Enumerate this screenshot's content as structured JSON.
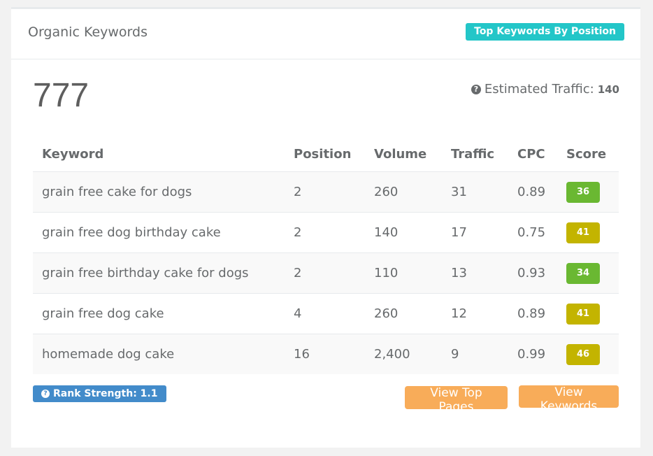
{
  "card": {
    "title": "Organic Keywords",
    "top_badge": "Top Keywords By Position",
    "total_keywords": "777",
    "estimated_traffic_label": "Estimated Traffic:",
    "estimated_traffic_value": "140"
  },
  "table": {
    "headers": [
      "Keyword",
      "Position",
      "Volume",
      "Traffic",
      "CPC",
      "Score"
    ],
    "rows": [
      {
        "keyword": "grain free cake for dogs",
        "position": "2",
        "volume": "260",
        "traffic": "31",
        "cpc": "0.89",
        "score": "36",
        "score_color": "#6ab832"
      },
      {
        "keyword": "grain free dog birthday cake",
        "position": "2",
        "volume": "140",
        "traffic": "17",
        "cpc": "0.75",
        "score": "41",
        "score_color": "#c3b400"
      },
      {
        "keyword": "grain free birthday cake for dogs",
        "position": "2",
        "volume": "110",
        "traffic": "13",
        "cpc": "0.93",
        "score": "34",
        "score_color": "#6ab832"
      },
      {
        "keyword": "grain free dog cake",
        "position": "4",
        "volume": "260",
        "traffic": "12",
        "cpc": "0.89",
        "score": "41",
        "score_color": "#c3b400"
      },
      {
        "keyword": "homemade dog cake",
        "position": "16",
        "volume": "2,400",
        "traffic": "9",
        "cpc": "0.99",
        "score": "46",
        "score_color": "#c3b400"
      }
    ]
  },
  "footer": {
    "rank_strength": "Rank Strength: 1.1",
    "view_top_pages": "View Top Pages",
    "view_keywords": "View Keywords"
  },
  "icons": {
    "question": "?"
  },
  "colors": {
    "teal": "#23c6c8",
    "blue": "#428bca",
    "orange": "#f8ac59",
    "score_green": "#6ab832",
    "score_olive": "#c3b400"
  }
}
